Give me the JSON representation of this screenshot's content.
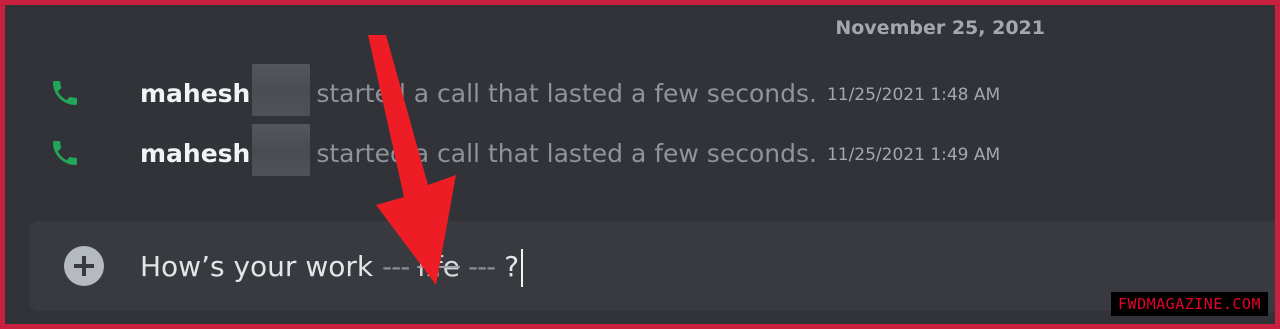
{
  "chat": {
    "date_divider": "November 25, 2021",
    "messages": [
      {
        "username": "mahesh",
        "text": "started a call that lasted a few seconds.",
        "timestamp": "11/25/2021 1:48 AM"
      },
      {
        "username": "mahesh",
        "text": "started a call that lasted a few seconds.",
        "timestamp": "11/25/2021 1:49 AM"
      }
    ]
  },
  "composer": {
    "text_before": "How’s your work",
    "strikethrough_dashes_left": "---",
    "strikethrough_word": "life",
    "strikethrough_dashes_right": "---",
    "text_after": "?"
  },
  "watermark": {
    "text": "FWDMAGAZINE.COM"
  },
  "colors": {
    "background": "#313338",
    "border": "#c8213f",
    "call_icon": "#23a55a",
    "annotation_arrow": "#ee1c24"
  },
  "icons": {
    "call": "phone-icon",
    "add": "plus-circle-icon",
    "annotation": "arrow-annotation"
  }
}
